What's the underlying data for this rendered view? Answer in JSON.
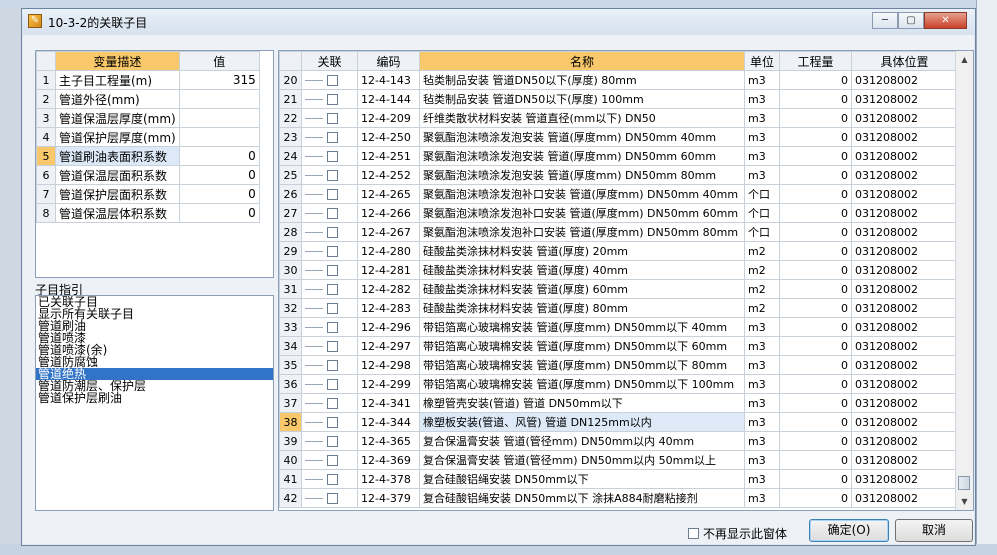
{
  "window": {
    "title": "10-3-2的关联子目",
    "minimize": "─",
    "maximize": "▢",
    "close": "✕"
  },
  "variables": {
    "headers": {
      "desc": "变量描述",
      "value": "值"
    },
    "rows": [
      {
        "idx": "1",
        "desc": "主子目工程量(m)",
        "value": "315"
      },
      {
        "idx": "2",
        "desc": "管道外径(mm)",
        "value": ""
      },
      {
        "idx": "3",
        "desc": "管道保温层厚度(mm)",
        "value": ""
      },
      {
        "idx": "4",
        "desc": "管道保护层厚度(mm)",
        "value": ""
      },
      {
        "idx": "5",
        "desc": "管道刷油表面积系数",
        "value": "0"
      },
      {
        "idx": "6",
        "desc": "管道保温层面积系数",
        "value": "0"
      },
      {
        "idx": "7",
        "desc": "管道保护层面积系数",
        "value": "0"
      },
      {
        "idx": "8",
        "desc": "管道保温层体积系数",
        "value": "0"
      }
    ]
  },
  "hints": {
    "label": "子目指引",
    "items": [
      "已关联子目",
      "显示所有关联子目",
      "管道刷油",
      "管道喷漆",
      "管道喷漆(余)",
      "管道防腐蚀",
      "管道绝热",
      "管道防潮层、保护层",
      "管道保护层刷油"
    ],
    "selected_index": 6
  },
  "table": {
    "headers": {
      "link": "关联",
      "code": "编码",
      "name": "名称",
      "unit": "单位",
      "qty": "工程量",
      "loc": "具体位置"
    },
    "rows": [
      {
        "idx": "20",
        "code": "12-4-143",
        "name": "毡类制品安装 管道DN50以下(厚度) 80mm",
        "unit": "m3",
        "qty": "0",
        "loc": "031208002"
      },
      {
        "idx": "21",
        "code": "12-4-144",
        "name": "毡类制品安装 管道DN50以下(厚度) 100mm",
        "unit": "m3",
        "qty": "0",
        "loc": "031208002"
      },
      {
        "idx": "22",
        "code": "12-4-209",
        "name": "纤维类散状材料安装 管道直径(mm以下) DN50",
        "unit": "m3",
        "qty": "0",
        "loc": "031208002"
      },
      {
        "idx": "23",
        "code": "12-4-250",
        "name": "聚氨酯泡沫喷涂发泡安装 管道(厚度mm) DN50mm 40mm",
        "unit": "m3",
        "qty": "0",
        "loc": "031208002"
      },
      {
        "idx": "24",
        "code": "12-4-251",
        "name": "聚氨酯泡沫喷涂发泡安装 管道(厚度mm) DN50mm 60mm",
        "unit": "m3",
        "qty": "0",
        "loc": "031208002"
      },
      {
        "idx": "25",
        "code": "12-4-252",
        "name": "聚氨酯泡沫喷涂发泡安装 管道(厚度mm) DN50mm 80mm",
        "unit": "m3",
        "qty": "0",
        "loc": "031208002"
      },
      {
        "idx": "26",
        "code": "12-4-265",
        "name": "聚氨酯泡沫喷涂发泡补口安装 管道(厚度mm) DN50mm 40mm",
        "unit": "个口",
        "qty": "0",
        "loc": "031208002"
      },
      {
        "idx": "27",
        "code": "12-4-266",
        "name": "聚氨酯泡沫喷涂发泡补口安装 管道(厚度mm) DN50mm 60mm",
        "unit": "个口",
        "qty": "0",
        "loc": "031208002"
      },
      {
        "idx": "28",
        "code": "12-4-267",
        "name": "聚氨酯泡沫喷涂发泡补口安装 管道(厚度mm) DN50mm 80mm",
        "unit": "个口",
        "qty": "0",
        "loc": "031208002"
      },
      {
        "idx": "29",
        "code": "12-4-280",
        "name": "硅酸盐类涂抹材料安装 管道(厚度) 20mm",
        "unit": "m2",
        "qty": "0",
        "loc": "031208002"
      },
      {
        "idx": "30",
        "code": "12-4-281",
        "name": "硅酸盐类涂抹材料安装 管道(厚度) 40mm",
        "unit": "m2",
        "qty": "0",
        "loc": "031208002"
      },
      {
        "idx": "31",
        "code": "12-4-282",
        "name": "硅酸盐类涂抹材料安装 管道(厚度) 60mm",
        "unit": "m2",
        "qty": "0",
        "loc": "031208002"
      },
      {
        "idx": "32",
        "code": "12-4-283",
        "name": "硅酸盐类涂抹材料安装 管道(厚度) 80mm",
        "unit": "m2",
        "qty": "0",
        "loc": "031208002"
      },
      {
        "idx": "33",
        "code": "12-4-296",
        "name": "带铝箔离心玻璃棉安装 管道(厚度mm) DN50mm以下 40mm",
        "unit": "m3",
        "qty": "0",
        "loc": "031208002"
      },
      {
        "idx": "34",
        "code": "12-4-297",
        "name": "带铝箔离心玻璃棉安装 管道(厚度mm) DN50mm以下 60mm",
        "unit": "m3",
        "qty": "0",
        "loc": "031208002"
      },
      {
        "idx": "35",
        "code": "12-4-298",
        "name": "带铝箔离心玻璃棉安装 管道(厚度mm) DN50mm以下 80mm",
        "unit": "m3",
        "qty": "0",
        "loc": "031208002"
      },
      {
        "idx": "36",
        "code": "12-4-299",
        "name": "带铝箔离心玻璃棉安装 管道(厚度mm) DN50mm以下 100mm",
        "unit": "m3",
        "qty": "0",
        "loc": "031208002"
      },
      {
        "idx": "37",
        "code": "12-4-341",
        "name": "橡塑管壳安装(管道) 管道 DN50mm以下",
        "unit": "m3",
        "qty": "0",
        "loc": "031208002"
      },
      {
        "idx": "38",
        "code": "12-4-344",
        "name": "橡塑板安装(管道、风管) 管道 DN125mm以内",
        "unit": "m3",
        "qty": "0",
        "loc": "031208002"
      },
      {
        "idx": "39",
        "code": "12-4-365",
        "name": "复合保温膏安装 管道(管径mm) DN50mm以内 40mm",
        "unit": "m3",
        "qty": "0",
        "loc": "031208002"
      },
      {
        "idx": "40",
        "code": "12-4-369",
        "name": "复合保温膏安装 管道(管径mm) DN50mm以内 50mm以上",
        "unit": "m3",
        "qty": "0",
        "loc": "031208002"
      },
      {
        "idx": "41",
        "code": "12-4-378",
        "name": "复合硅酸铝绳安装 DN50mm以下",
        "unit": "m3",
        "qty": "0",
        "loc": "031208002"
      },
      {
        "idx": "42",
        "code": "12-4-379",
        "name": "复合硅酸铝绳安装 DN50mm以下 涂抹A884耐磨粘接剂",
        "unit": "m3",
        "qty": "0",
        "loc": "031208002"
      }
    ],
    "selected_row": "38"
  },
  "footer": {
    "no_show": "不再显示此窗体",
    "ok": "确定(O)",
    "cancel": "取消"
  },
  "colors": {
    "header_highlight": "#f9c86a",
    "selection": "#3173c6",
    "row_highlight": "#dde9f7"
  }
}
